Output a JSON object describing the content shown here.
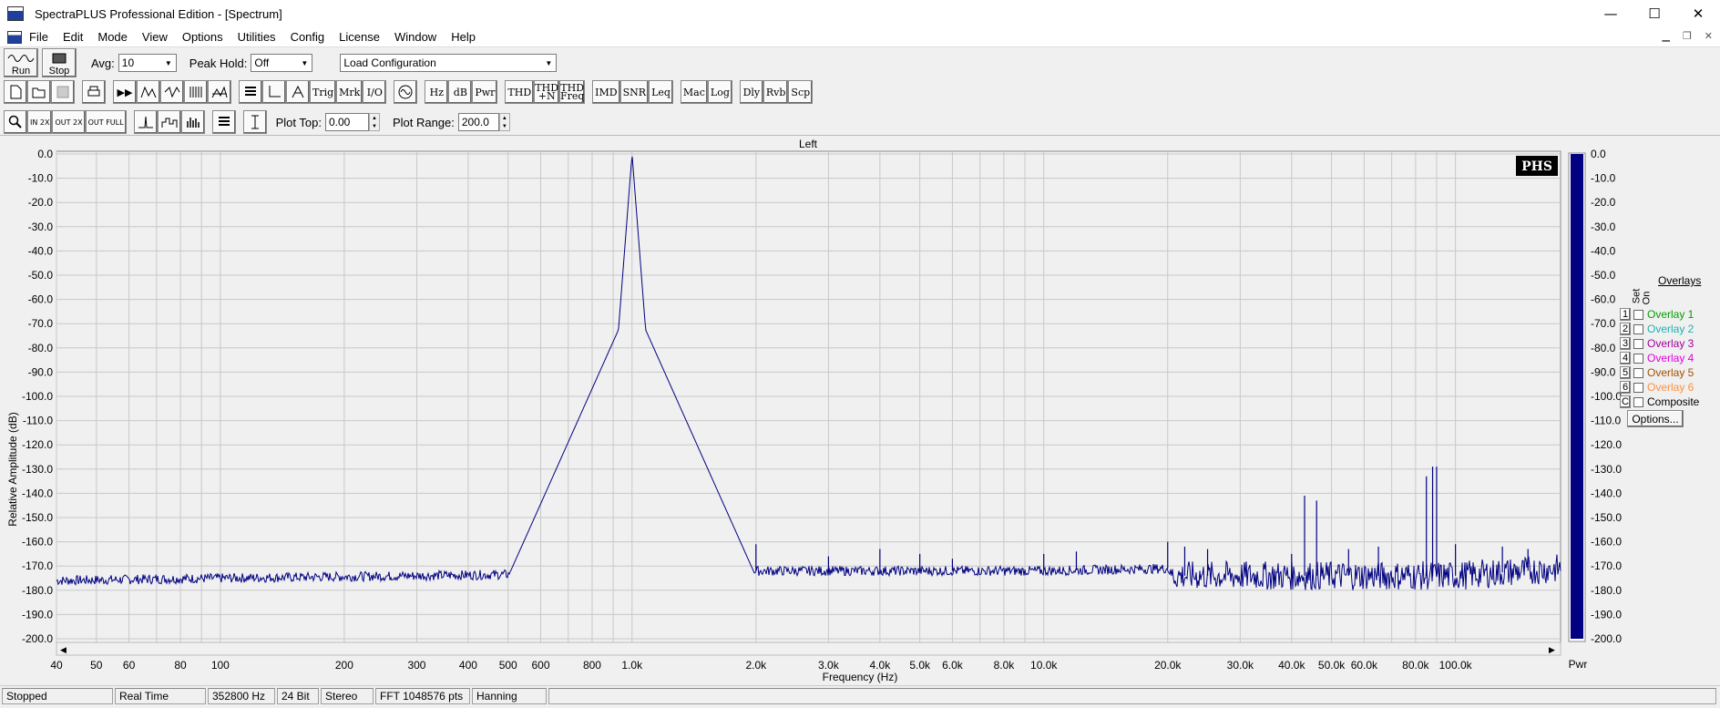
{
  "window": {
    "title": "SpectraPLUS Professional Edition - [Spectrum]",
    "minimize": "—",
    "maximize": "☐",
    "close": "✕"
  },
  "menu": [
    "File",
    "Edit",
    "Mode",
    "View",
    "Options",
    "Utilities",
    "Config",
    "License",
    "Window",
    "Help"
  ],
  "toolbar": {
    "run_label": "Run",
    "stop_label": "Stop",
    "avg_label": "Avg:",
    "avg_value": "10",
    "peak_hold_label": "Peak Hold:",
    "peak_hold_value": "Off",
    "config_value": "Load Configuration"
  },
  "toolbar2": {
    "buttons": [
      "Trig",
      "Mrk",
      "I/O",
      "Hz",
      "dB",
      "Pwr",
      "THD",
      "THD +N",
      "THD Freq",
      "IMD",
      "SNR",
      "Leq",
      "Mac",
      "Log",
      "Dly",
      "Rvb",
      "Scp"
    ]
  },
  "toolbar3": {
    "plot_top_label": "Plot Top:",
    "plot_top_value": "0.00",
    "plot_range_label": "Plot Range:",
    "plot_range_value": "200.0",
    "zoom_labels": [
      "IN 2X",
      "OUT 2X",
      "OUT FULL"
    ]
  },
  "plot": {
    "title": "Left",
    "logo": "PHS",
    "ylabel": "Relative Amplitude (dB)",
    "xlabel": "Frequency (Hz)",
    "bar_label": "Pwr"
  },
  "chart_data": {
    "type": "line",
    "title": "Left",
    "xlabel": "Frequency (Hz)",
    "ylabel": "Relative Amplitude (dB)",
    "xscale": "log",
    "xlim": [
      40,
      180000
    ],
    "ylim": [
      -200,
      0
    ],
    "x_ticks": [
      {
        "v": 40,
        "t": "40"
      },
      {
        "v": 50,
        "t": "50"
      },
      {
        "v": 60,
        "t": "60"
      },
      {
        "v": 80,
        "t": "80"
      },
      {
        "v": 100,
        "t": "100"
      },
      {
        "v": 200,
        "t": "200"
      },
      {
        "v": 300,
        "t": "300"
      },
      {
        "v": 400,
        "t": "400"
      },
      {
        "v": 500,
        "t": "500"
      },
      {
        "v": 600,
        "t": "600"
      },
      {
        "v": 800,
        "t": "800"
      },
      {
        "v": 1000,
        "t": "1.0k"
      },
      {
        "v": 2000,
        "t": "2.0k"
      },
      {
        "v": 3000,
        "t": "3.0k"
      },
      {
        "v": 4000,
        "t": "4.0k"
      },
      {
        "v": 5000,
        "t": "5.0k"
      },
      {
        "v": 6000,
        "t": "6.0k"
      },
      {
        "v": 8000,
        "t": "8.0k"
      },
      {
        "v": 10000,
        "t": "10.0k"
      },
      {
        "v": 20000,
        "t": "20.0k"
      },
      {
        "v": 30000,
        "t": "30.0k"
      },
      {
        "v": 40000,
        "t": "40.0k"
      },
      {
        "v": 50000,
        "t": "50.0k"
      },
      {
        "v": 60000,
        "t": "60.0k"
      },
      {
        "v": 80000,
        "t": "80.0k"
      },
      {
        "v": 100000,
        "t": "100.0k"
      }
    ],
    "y_ticks": [
      "0.0",
      "-10.0",
      "-20.0",
      "-30.0",
      "-40.0",
      "-50.0",
      "-60.0",
      "-70.0",
      "-80.0",
      "-90.0",
      "-100.0",
      "-110.0",
      "-120.0",
      "-130.0",
      "-140.0",
      "-150.0",
      "-160.0",
      "-170.0",
      "-180.0",
      "-190.0",
      "-200.0"
    ],
    "bar_ticks": [
      "0.0",
      "-10.0",
      "-20.0",
      "-30.0",
      "-40.0",
      "-50.0",
      "-60.0",
      "-70.0",
      "-80.0",
      "-90.0",
      "-100.0",
      "-110.0",
      "-120.0",
      "-130.0",
      "-140.0",
      "-150.0",
      "-160.0",
      "-170.0",
      "-180.0",
      "-190.0",
      "-200.0"
    ],
    "series": [
      {
        "color": "#000080",
        "noise_floor": [
          [
            40,
            -176
          ],
          [
            100,
            -175
          ],
          [
            300,
            -174
          ],
          [
            800,
            -173
          ],
          [
            1200,
            -173
          ],
          [
            2000,
            -172
          ],
          [
            5000,
            -172
          ],
          [
            10000,
            -172
          ],
          [
            20000,
            -171
          ],
          [
            20500,
            -174
          ],
          [
            40000,
            -174
          ],
          [
            60000,
            -174
          ],
          [
            100000,
            -174
          ],
          [
            180000,
            -171
          ]
        ],
        "peak": {
          "x": 1000,
          "y": 0
        },
        "spurs": [
          [
            2000,
            -161
          ],
          [
            3000,
            -166
          ],
          [
            4000,
            -163
          ],
          [
            5000,
            -165
          ],
          [
            6000,
            -167
          ],
          [
            10000,
            -165
          ],
          [
            12000,
            -164
          ],
          [
            20000,
            -160
          ],
          [
            22000,
            -162
          ],
          [
            25000,
            -163
          ],
          [
            40000,
            -165
          ],
          [
            43000,
            -141
          ],
          [
            46000,
            -143
          ],
          [
            55000,
            -163
          ],
          [
            65000,
            -162
          ],
          [
            85000,
            -133
          ],
          [
            88000,
            -129
          ],
          [
            90000,
            -129
          ],
          [
            100000,
            -161
          ],
          [
            130000,
            -162
          ],
          [
            150000,
            -163
          ]
        ],
        "power_level": -200
      }
    ],
    "grid": true
  },
  "overlays": {
    "header": "Overlays",
    "set_label": "Set",
    "on_label": "On",
    "items": [
      {
        "num": "1",
        "name": "Overlay 1",
        "color": "#00a000"
      },
      {
        "num": "2",
        "name": "Overlay 2",
        "color": "#20b0b0"
      },
      {
        "num": "3",
        "name": "Overlay 3",
        "color": "#a000a0"
      },
      {
        "num": "4",
        "name": "Overlay 4",
        "color": "#e000e0"
      },
      {
        "num": "5",
        "name": "Overlay 5",
        "color": "#a05000"
      },
      {
        "num": "6",
        "name": "Overlay 6",
        "color": "#ff9040"
      },
      {
        "num": "C",
        "name": "Composite",
        "color": "#000000"
      }
    ],
    "options_label": "Options..."
  },
  "status": [
    "Stopped",
    "Real Time",
    "352800 Hz",
    "24 Bit",
    "Stereo",
    "FFT 1048576 pts",
    "Hanning"
  ]
}
